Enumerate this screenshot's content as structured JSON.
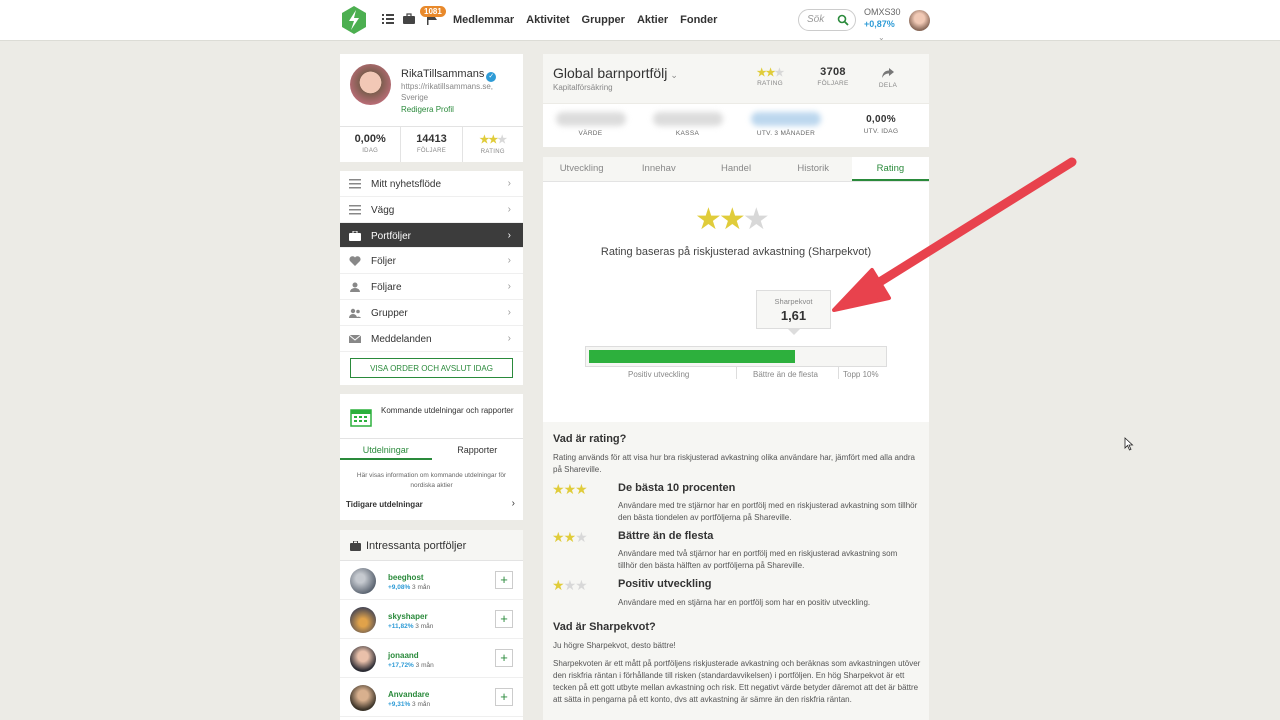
{
  "topbar": {
    "badge": "1081",
    "nav": [
      "Medlemmar",
      "Aktivitet",
      "Grupper",
      "Aktier",
      "Fonder"
    ],
    "search_placeholder": "Sök",
    "index_name": "OMXS30",
    "index_change": "+0,87%"
  },
  "profile": {
    "name": "RikaTillsammans",
    "url": "https://rikatillsammans.se,",
    "country": "Sverige",
    "edit": "Redigera Profil",
    "stats": [
      {
        "value": "0,00%",
        "label": "IDAG"
      },
      {
        "value": "14413",
        "label": "FÖLJARE"
      },
      {
        "label": "RATING",
        "stars": 2
      }
    ]
  },
  "menu": {
    "items": [
      {
        "label": "Mitt nyhetsflöde",
        "icon": "feed-icon"
      },
      {
        "label": "Vägg",
        "icon": "wall-icon"
      },
      {
        "label": "Portföljer",
        "icon": "briefcase-icon",
        "active": true
      },
      {
        "label": "Följer",
        "icon": "heart-icon"
      },
      {
        "label": "Följare",
        "icon": "person-icon"
      },
      {
        "label": "Grupper",
        "icon": "group-icon"
      },
      {
        "label": "Meddelanden",
        "icon": "envelope-icon"
      }
    ],
    "order_button": "VISA ORDER OCH AVSLUT IDAG"
  },
  "dividends": {
    "title": "Kommande utdelningar och rapporter",
    "tabs": [
      "Utdelningar",
      "Rapporter"
    ],
    "info": "Här visas information om kommande utdelningar för nordiska aktier",
    "previous": "Tidigare utdelningar"
  },
  "interesting": {
    "title": "Intressanta portföljer",
    "items": [
      {
        "name": "beeghost",
        "gain": "+9,08%",
        "period": "3 mån"
      },
      {
        "name": "skyshaper",
        "gain": "+11,82%",
        "period": "3 mån"
      },
      {
        "name": "jonaand",
        "gain": "+17,72%",
        "period": "3 mån"
      },
      {
        "name": "Anvandare",
        "gain": "+9,31%",
        "period": "3 mån"
      }
    ]
  },
  "portfolio": {
    "title": "Global barnportfölj",
    "subtitle": "Kapitalförsäkring",
    "rating_label": "RATING",
    "rating_stars": 2,
    "followers": "3708",
    "followers_label": "FÖLJARE",
    "share_label": "DELA",
    "values": [
      {
        "label": "VÄRDE"
      },
      {
        "label": "KASSA"
      },
      {
        "label": "UTV. 3 MÅNADER"
      },
      {
        "label": "UTV. IDAG",
        "value": "0,00%"
      }
    ]
  },
  "tabs": {
    "items": [
      "Utveckling",
      "Innehav",
      "Handel",
      "Historik",
      "Rating"
    ],
    "active": "Rating"
  },
  "rating": {
    "stars": 2,
    "max_stars": 3,
    "text": "Rating baseras på riskjusterad avkastning (Sharpekvot)",
    "sharpe_label": "Sharpekvot",
    "sharpe_value": "1,61",
    "bar_fill_fraction": 0.7,
    "bar_labels": [
      "Positiv utveckling",
      "Bättre än de flesta",
      "Topp 10%"
    ]
  },
  "info": {
    "what_title": "Vad är rating?",
    "what_text": "Rating används för att visa hur bra riskjusterad avkastning olika användare har, jämfört med alla andra på Shareville.",
    "levels": [
      {
        "stars": 3,
        "title": "De bästa 10 procenten",
        "desc": "Användare med tre stjärnor har en portfölj med en riskjusterad avkastning som tillhör den bästa tiondelen av portföljerna på Shareville."
      },
      {
        "stars": 2,
        "title": "Bättre än de flesta",
        "desc": "Användare med två stjärnor har en portfölj med en riskjusterad avkastning som tillhör den bästa hälften av portföljerna på Shareville."
      },
      {
        "stars": 1,
        "title": "Positiv utveckling",
        "desc": "Användare med en stjärna har en portfölj som har en positiv utveckling."
      }
    ],
    "sharpe_title": "Vad är Sharpekvot?",
    "sharpe_intro": "Ju högre Sharpekvot, desto bättre!",
    "sharpe_text": "Sharpekvoten är ett mått på portföljens riskjusterade avkastning och beräknas som avkastningen utöver den riskfria räntan i förhållande till risken (standardavvikelsen) i portföljen. En hög Sharpekvot är ett tecken på ett gott utbyte mellan avkastning och risk. Ett negativt värde betyder däremot att det är bättre att sätta in pengarna på ett konto, dvs att avkastning är sämre än den riskfria räntan."
  },
  "colors": {
    "accent_green": "#2a8a3b",
    "bar_green": "#2db03d",
    "star_gold": "#e0cc3a",
    "arrow_red": "#e8424d",
    "positive_blue": "#2e9bd6"
  }
}
